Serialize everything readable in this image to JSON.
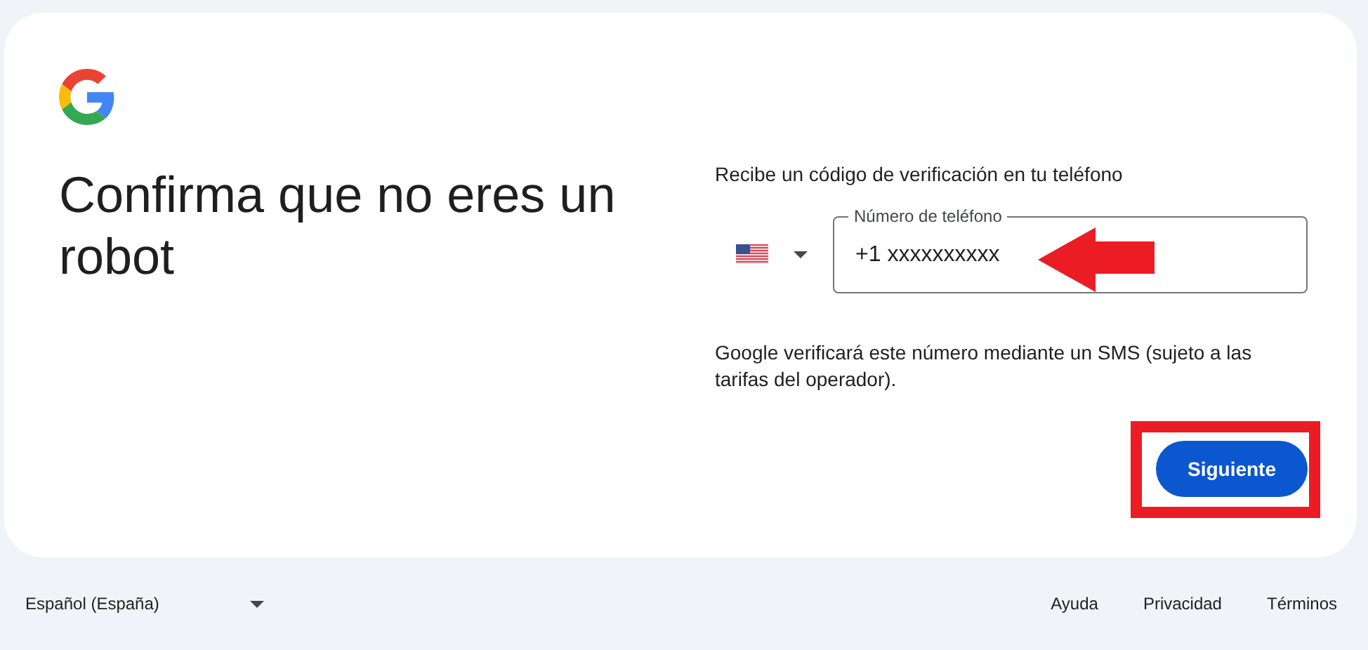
{
  "card": {
    "title": "Confirma que no eres un robot",
    "prompt": "Recibe un código de verificación en tu teléfono",
    "phone_field": {
      "label": "Número de teléfono",
      "value": "+1 xxxxxxxxxx"
    },
    "helper": "Google verificará este número mediante un SMS (sujeto a las tarifas del operador).",
    "button": "Siguiente"
  },
  "annotations": [
    {
      "kind": "arrow"
    },
    {
      "kind": "frame"
    }
  ],
  "footer": {
    "language": "Español (España)",
    "links": [
      "Ayuda",
      "Privacidad",
      "Términos"
    ]
  }
}
